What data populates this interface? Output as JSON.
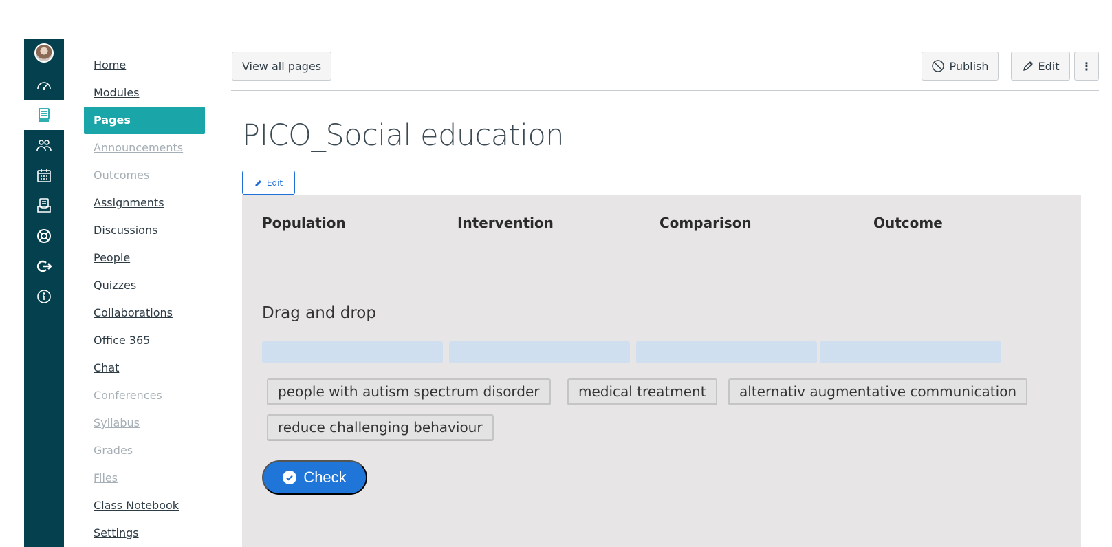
{
  "course_nav": {
    "items": [
      {
        "label": "Home",
        "state": "normal"
      },
      {
        "label": "Modules",
        "state": "normal"
      },
      {
        "label": "Pages",
        "state": "active"
      },
      {
        "label": "Announcements",
        "state": "disabled"
      },
      {
        "label": "Outcomes",
        "state": "disabled"
      },
      {
        "label": "Assignments",
        "state": "normal"
      },
      {
        "label": "Discussions",
        "state": "normal"
      },
      {
        "label": "People",
        "state": "normal"
      },
      {
        "label": "Quizzes",
        "state": "normal"
      },
      {
        "label": "Collaborations",
        "state": "normal"
      },
      {
        "label": "Office 365",
        "state": "normal"
      },
      {
        "label": "Chat",
        "state": "normal"
      },
      {
        "label": "Conferences",
        "state": "disabled"
      },
      {
        "label": "Syllabus",
        "state": "disabled"
      },
      {
        "label": "Grades",
        "state": "disabled"
      },
      {
        "label": "Files",
        "state": "disabled"
      },
      {
        "label": "Class Notebook",
        "state": "normal"
      },
      {
        "label": "Settings",
        "state": "normal"
      }
    ]
  },
  "global_nav": {
    "icons": [
      "avatar",
      "dashboard-icon",
      "courses-icon",
      "groups-icon",
      "calendar-icon",
      "inbox-icon",
      "help-icon",
      "logout-icon",
      "info-icon"
    ]
  },
  "header": {
    "view_all_label": "View all pages",
    "publish_label": "Publish",
    "edit_label": "Edit",
    "more_label": "⋮"
  },
  "page": {
    "title": "PICO_Social education",
    "inline_edit_label": "Edit"
  },
  "activity": {
    "columns": [
      "Population",
      "Intervention",
      "Comparison",
      "Outcome"
    ],
    "drag_title": "Drag and drop",
    "chips": [
      "people with autism spectrum disorder",
      "medical treatment",
      "alternativ augmentative communication",
      "reduce challenging behaviour"
    ],
    "check_label": "Check"
  },
  "colors": {
    "global_nav_bg": "#05404f",
    "active_nav": "#1aa6a8",
    "primary_button": "#1f75d8",
    "activity_bg": "#e7e5e6",
    "dropzone": "#cfdff0"
  }
}
